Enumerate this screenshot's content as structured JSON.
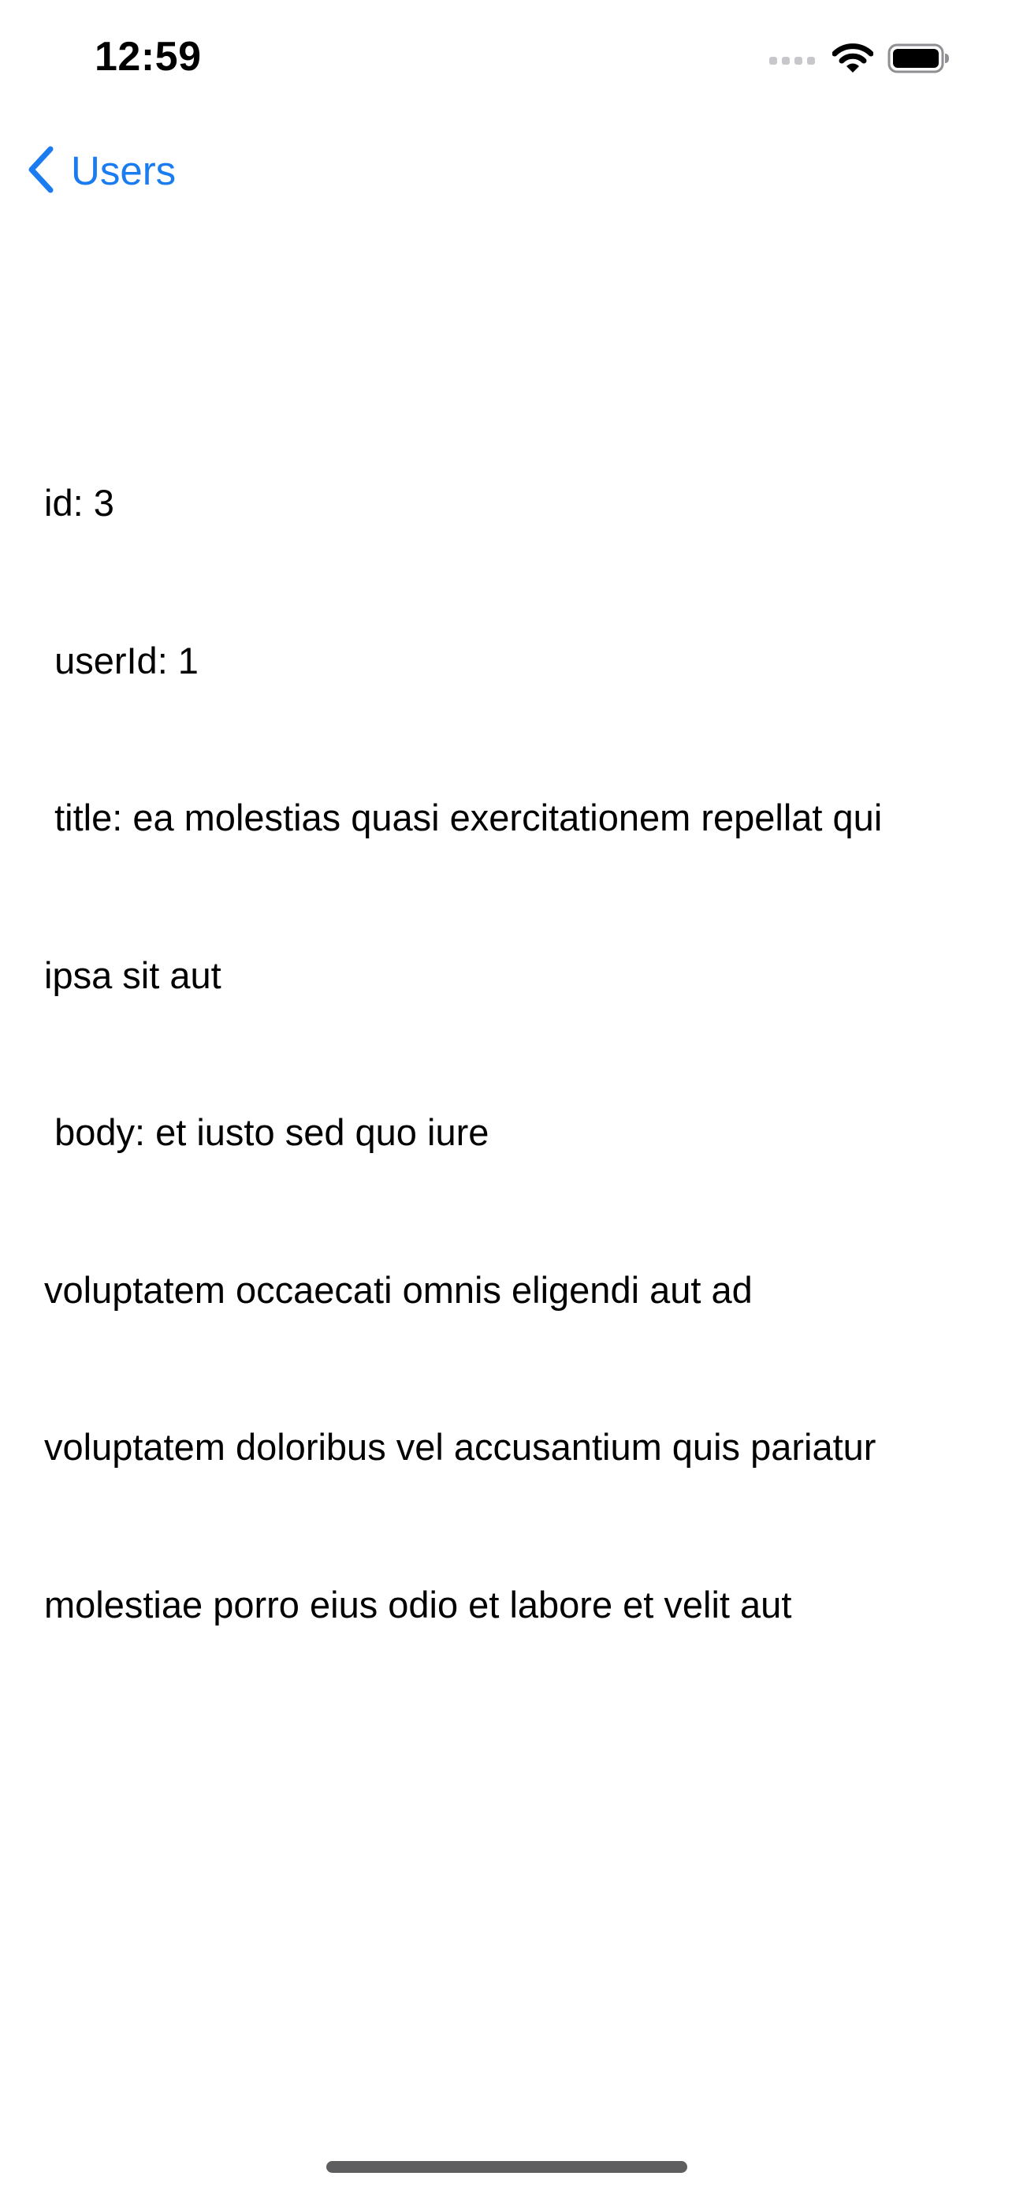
{
  "status_bar": {
    "time": "12:59",
    "icons": [
      "cellular-signal-icon",
      "wifi-icon",
      "battery-icon"
    ]
  },
  "nav": {
    "back_label": "Users",
    "back_icon": "chevron-left-icon",
    "accent_color": "#1a7cf0"
  },
  "detail": {
    "lines": [
      "id: 3",
      " userId: 1",
      " title: ea molestias quasi exercitationem repellat qui",
      "ipsa sit aut",
      " body: et iusto sed quo iure",
      "voluptatem occaecati omnis eligendi aut ad",
      "voluptatem doloribus vel accusantium quis pariatur",
      "molestiae porro eius odio et labore et velit aut"
    ]
  }
}
